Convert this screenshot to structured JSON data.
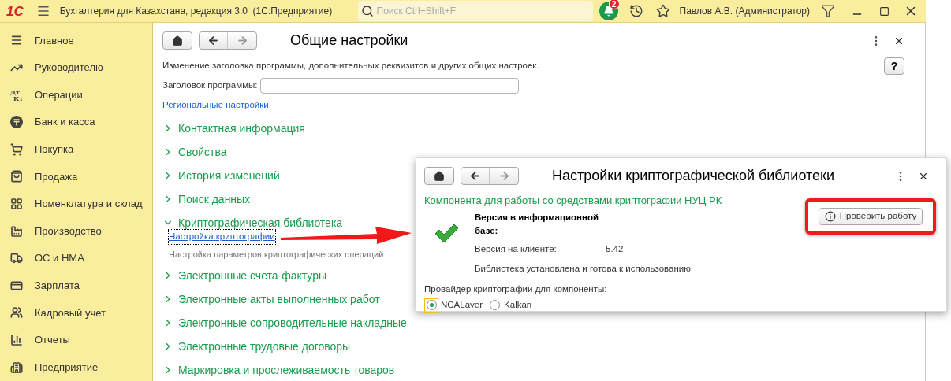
{
  "app_bar": {
    "logo": "1С",
    "title": "Бухгалтерия для Казахстана, редакция 3.0  (1С:Предприятие)",
    "search": {
      "placeholder": "Поиск Ctrl+Shift+F"
    },
    "notification_count": "2",
    "user": "Павлов А.В. (Администратор)"
  },
  "sidebar": {
    "items": [
      {
        "label": "Главное"
      },
      {
        "label": "Руководителю"
      },
      {
        "label": "Операции",
        "icon_text": [
          "Дт",
          "Кт"
        ]
      },
      {
        "label": "Банк и касса"
      },
      {
        "label": "Покупка"
      },
      {
        "label": "Продажа"
      },
      {
        "label": "Номенклатура и склад"
      },
      {
        "label": "Производство"
      },
      {
        "label": "ОС и НМА"
      },
      {
        "label": "Зарплата"
      },
      {
        "label": "Кадровый учет"
      },
      {
        "label": "Отчеты"
      },
      {
        "label": "Предприятие"
      }
    ]
  },
  "form": {
    "title": "Общие настройки",
    "description": "Изменение заголовка программы, дополнительных реквизитов и других общих настроек.",
    "help_button": "?",
    "field": {
      "label": "Заголовок программы:"
    },
    "link": "Региональные настройки",
    "sections": [
      {
        "label": "Контактная информация",
        "expanded": false
      },
      {
        "label": "Свойства",
        "expanded": false
      },
      {
        "label": "История изменений",
        "expanded": false
      },
      {
        "label": "Поиск данных",
        "expanded": false
      },
      {
        "label": "Криптографическая библиотека",
        "expanded": true,
        "children": [
          {
            "link": "Настройка криптографии",
            "description": "Настройка параметров криптографических операций"
          }
        ]
      },
      {
        "label": "Электронные счета-фактуры",
        "expanded": false
      },
      {
        "label": "Электронные акты выполненных работ",
        "expanded": false
      },
      {
        "label": "Электронные сопроводительные накладные",
        "expanded": false
      },
      {
        "label": "Электронные трудовые договоры",
        "expanded": false
      },
      {
        "label": "Маркировка и прослеживаемость товаров",
        "expanded": false
      }
    ]
  },
  "dialog": {
    "title": "Настройки криптографической библиотеки",
    "subtitle": "Компонента для работы со средствами криптографии НУЦ РК",
    "versions": [
      {
        "label": "Версия в информационной базе:",
        "bold": true
      },
      {
        "label": "Версия на клиенте:",
        "value": "5.42",
        "bold": false
      }
    ],
    "status": "Библиотека установлена и готова к использованию",
    "provider_label": "Провайдер криптографии для компоненты:",
    "providers": [
      {
        "label": "NCALayer",
        "selected": true
      },
      {
        "label": "Kalkan",
        "selected": false
      }
    ],
    "check_button": "Проверить работу"
  }
}
